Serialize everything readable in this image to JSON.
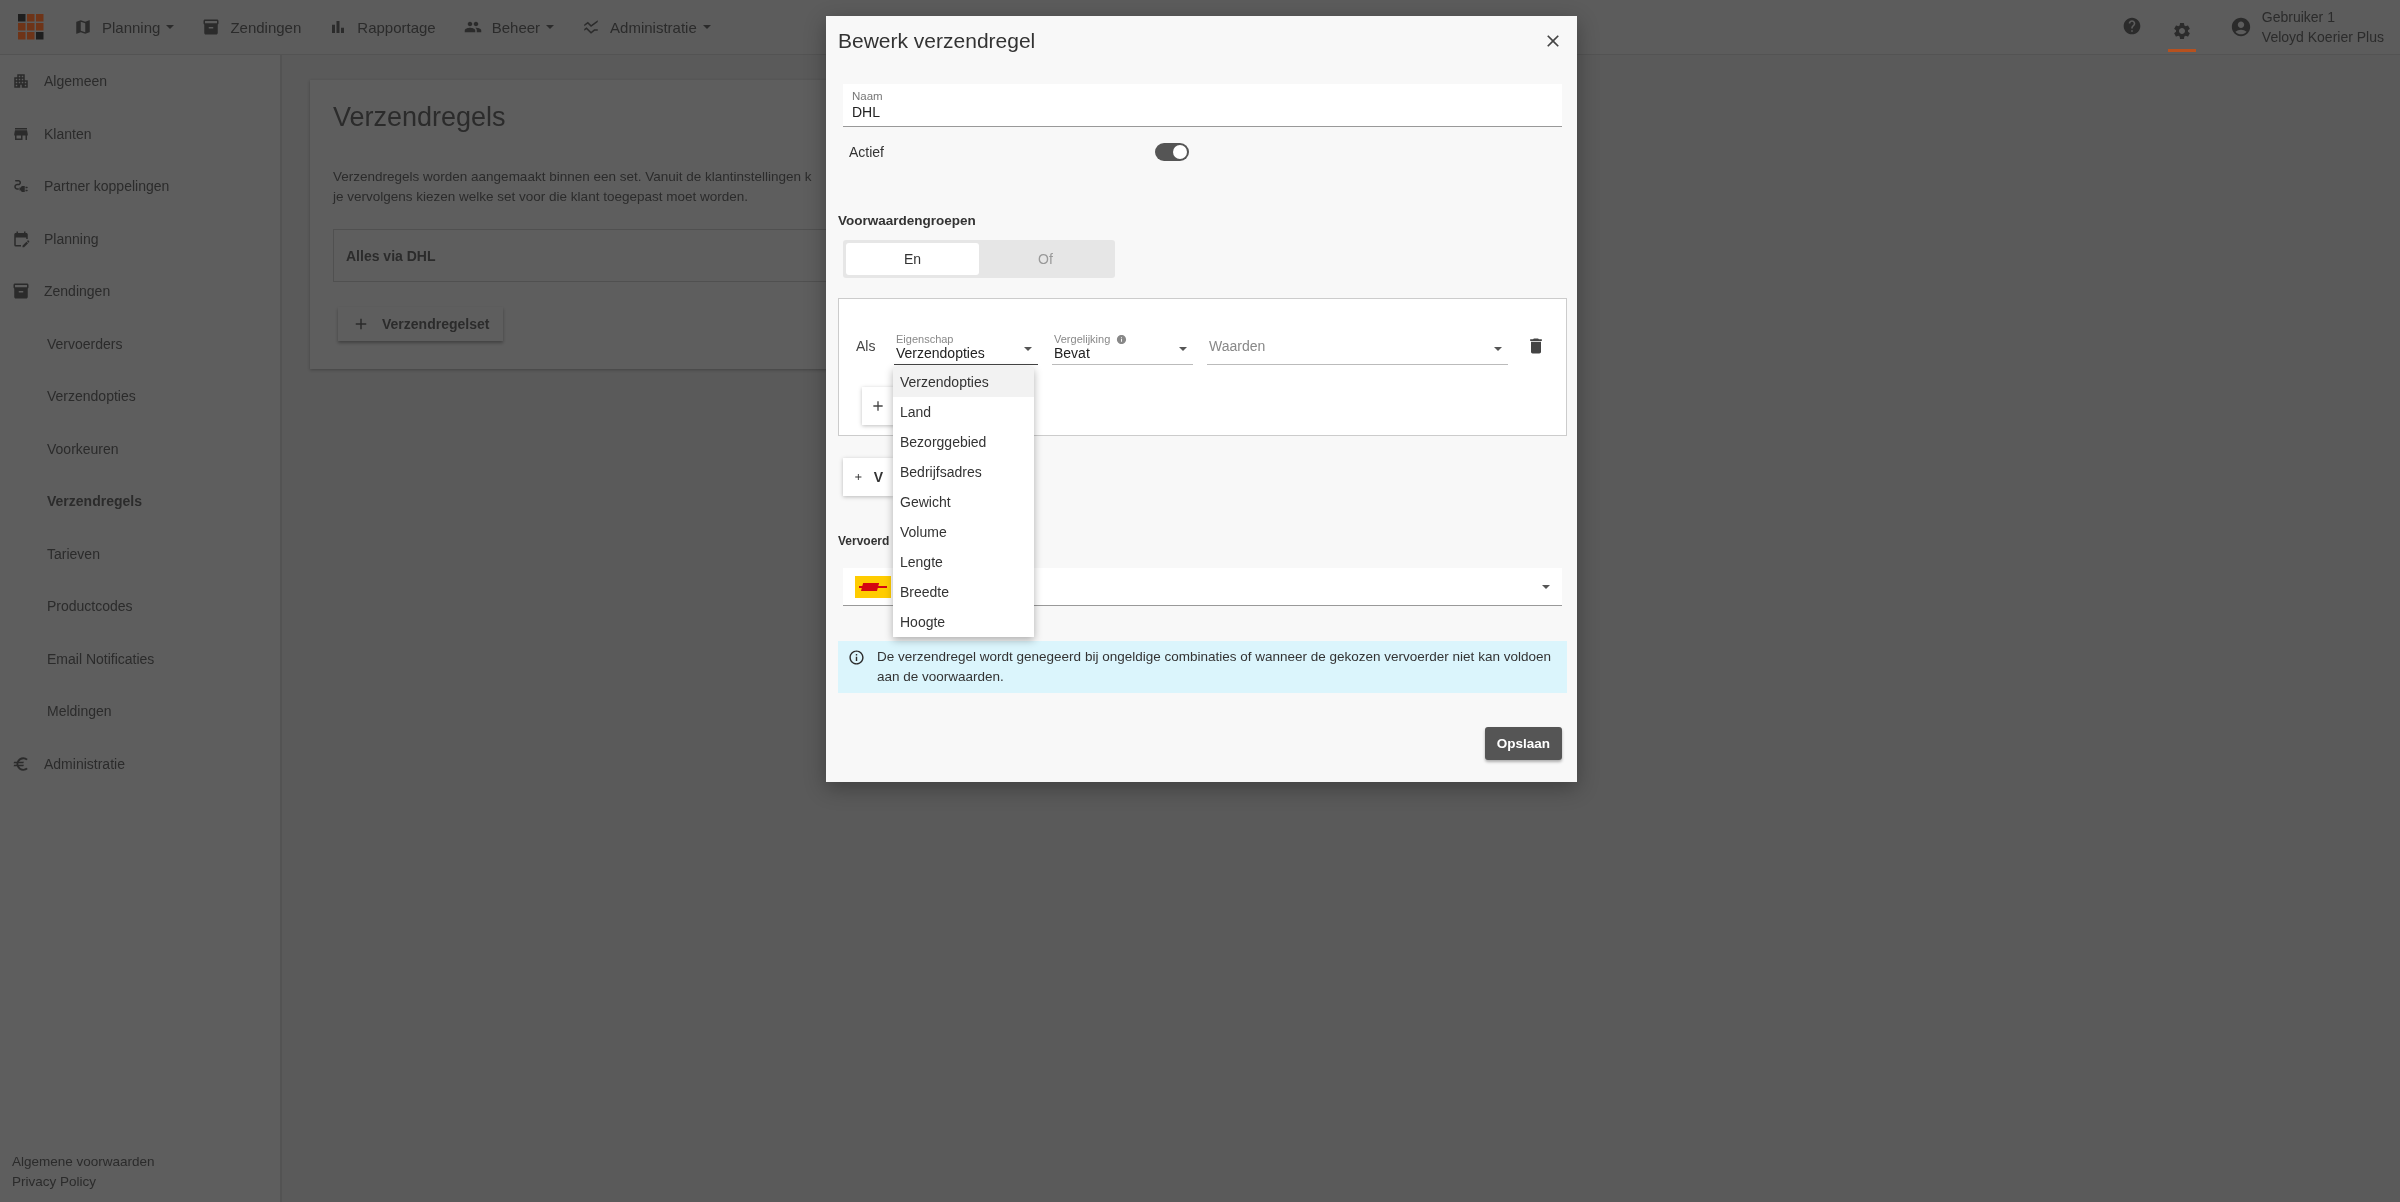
{
  "top_bar": {
    "menu": [
      {
        "label": "Planning",
        "kind": "map",
        "dropdown": true
      },
      {
        "label": "Zendingen",
        "kind": "package",
        "dropdown": false
      },
      {
        "label": "Rapportage",
        "kind": "chart",
        "dropdown": false
      },
      {
        "label": "Beheer",
        "kind": "people",
        "dropdown": true
      },
      {
        "label": "Administratie",
        "kind": "finance",
        "dropdown": true
      }
    ],
    "tools": [
      {
        "kind": "help",
        "selected": false
      },
      {
        "kind": "settings",
        "selected": true
      }
    ],
    "user": {
      "name": "Gebruiker 1",
      "company": "Veloyd Koerier Plus"
    }
  },
  "sidebar": {
    "items": [
      {
        "label": "Algemeen",
        "kind": "building",
        "selected": false
      },
      {
        "label": "Klanten",
        "kind": "store",
        "selected": false
      },
      {
        "label": "Partner koppelingen",
        "kind": "plug",
        "selected": false
      },
      {
        "label": "Planning",
        "kind": "calendar",
        "selected": false
      },
      {
        "label": "Zendingen",
        "kind": "package",
        "selected": false,
        "children": [
          {
            "label": "Vervoerders",
            "selected": false
          },
          {
            "label": "Verzendopties",
            "selected": false
          },
          {
            "label": "Voorkeuren",
            "selected": false
          },
          {
            "label": "Verzendregels",
            "selected": true
          },
          {
            "label": "Tarieven",
            "selected": false
          },
          {
            "label": "Productcodes",
            "selected": false
          },
          {
            "label": "Email Notificaties",
            "selected": false
          },
          {
            "label": "Meldingen",
            "selected": false
          }
        ]
      },
      {
        "label": "Administratie",
        "kind": "euro",
        "selected": false
      }
    ],
    "footer_links": [
      "Algemene voorwaarden",
      "Privacy Policy"
    ]
  },
  "page": {
    "title": "Verzendregels",
    "description_lines": [
      "Verzendregels worden aangemaakt binnen een set. Vanuit de klantinstellingen k",
      "je vervolgens kiezen welke set voor die klant toegepast moet worden."
    ],
    "rule_sets": [
      {
        "name": "Alles via DHL"
      }
    ],
    "add_button": "Verzendregelset"
  },
  "dialog": {
    "title": "Bewerk verzendregel",
    "name_field": {
      "label": "Naam",
      "value": "DHL"
    },
    "active": {
      "label": "Actief",
      "on": true
    },
    "groups_heading": "Voorwaardengroepen",
    "group_mode": [
      {
        "label": "En",
        "selected": true
      },
      {
        "label": "Of",
        "selected": false
      }
    ],
    "condition": {
      "prefix": "Als",
      "property": {
        "label": "Eigenschap",
        "value": "Verzendopties"
      },
      "comparison": {
        "label": "Vergelijking",
        "value": "Bevat"
      },
      "values": {
        "placeholder": "Waarden"
      }
    },
    "property_options": [
      {
        "label": "Verzendopties",
        "selected": true
      },
      {
        "label": "Land",
        "selected": false
      },
      {
        "label": "Bezorggebied",
        "selected": false
      },
      {
        "label": "Bedrijfsadres",
        "selected": false
      },
      {
        "label": "Gewicht",
        "selected": false
      },
      {
        "label": "Volume",
        "selected": false
      },
      {
        "label": "Lengte",
        "selected": false
      },
      {
        "label": "Breedte",
        "selected": false
      },
      {
        "label": "Hoogte",
        "selected": false
      }
    ],
    "add_group_button": "V",
    "carrier_heading": "Vervoerd",
    "notice": "De verzendregel wordt genegeerd bij ongeldige combinaties of wanneer de gekozen vervoerder niet kan voldoen aan de voorwaarden.",
    "save_button": "Opslaan"
  }
}
